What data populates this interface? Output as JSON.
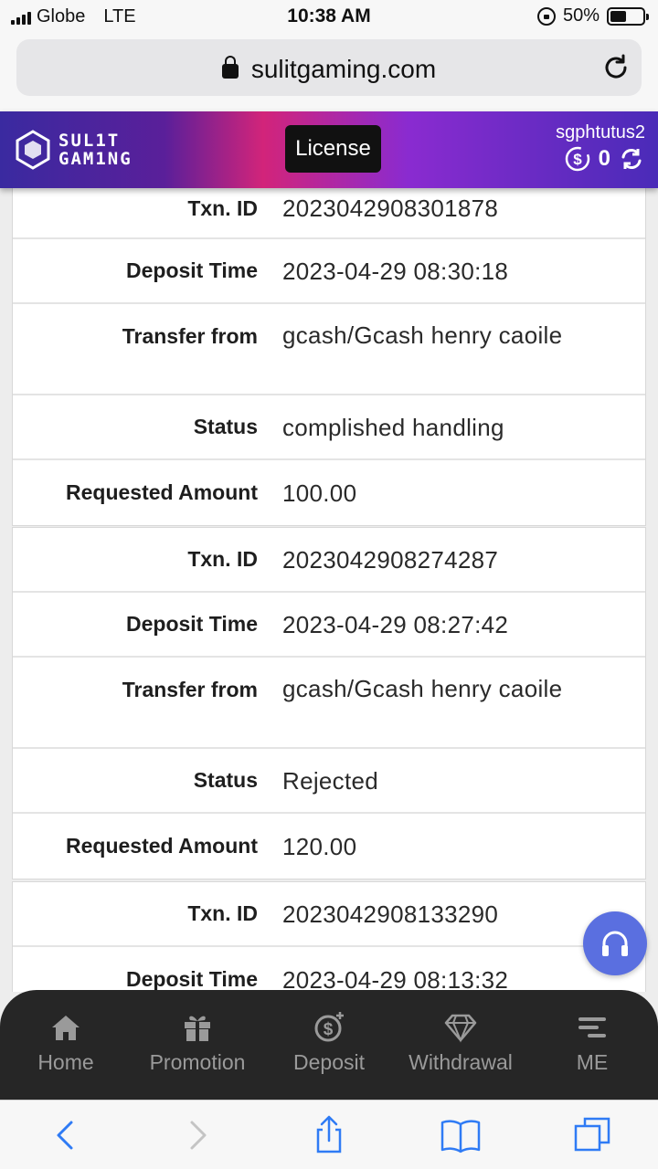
{
  "status_bar": {
    "carrier": "Globe",
    "network": "LTE",
    "time": "10:38 AM",
    "battery_pct_label": "50%",
    "battery_level": 0.5
  },
  "browser": {
    "url": "sulitgaming.com"
  },
  "header": {
    "logo_line1": "SUL1T",
    "logo_line2": "GAM1NG",
    "license_label": "License",
    "username": "sgphtutus2",
    "balance": "0"
  },
  "transactions": [
    {
      "txn_label": "Txn. ID",
      "txn_id": "2023042908301878",
      "time_label": "Deposit Time",
      "time": "2023-04-29 08:30:18",
      "from_label": "Transfer from",
      "from": "gcash/Gcash henry caoile",
      "status_label": "Status",
      "status": "complished handling",
      "amount_label": "Requested Amount",
      "amount": "100.00"
    },
    {
      "txn_label": "Txn. ID",
      "txn_id": "2023042908274287",
      "time_label": "Deposit Time",
      "time": "2023-04-29 08:27:42",
      "from_label": "Transfer from",
      "from": "gcash/Gcash henry caoile",
      "status_label": "Status",
      "status": "Rejected",
      "amount_label": "Requested Amount",
      "amount": "120.00"
    },
    {
      "txn_label": "Txn. ID",
      "txn_id": "2023042908133290",
      "time_label": "Deposit Time",
      "time": "2023-04-29 08:13:32"
    }
  ],
  "nav": {
    "home": "Home",
    "promotion": "Promotion",
    "deposit": "Deposit",
    "withdrawal": "Withdrawal",
    "me": "ME"
  },
  "colors": {
    "header_gradient_start": "#3a2aa0",
    "header_gradient_mid": "#d2247a",
    "support_fab": "#5a6fe0",
    "nav_bg": "#262626",
    "safari_blue": "#2f7bf5"
  },
  "icons": [
    "signal-icon",
    "lock-icon",
    "reload-icon",
    "dollar-coin-icon",
    "refresh-icon",
    "headphones-icon",
    "home-icon",
    "gift-icon",
    "deposit-icon",
    "diamond-icon",
    "menu-icon",
    "back-icon",
    "forward-icon",
    "share-icon",
    "bookmarks-icon",
    "tabs-icon"
  ]
}
